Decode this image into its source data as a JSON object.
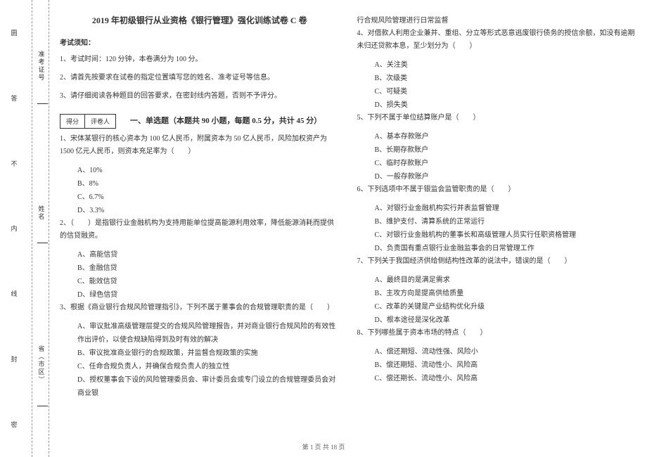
{
  "margin": {
    "binding": [
      "圆",
      "答",
      "不",
      "内",
      "线",
      "封",
      "密"
    ],
    "fields": [
      "准考证号",
      "姓名",
      "省（市区）"
    ]
  },
  "title": "2019 年初级银行从业资格《银行管理》强化训练试卷 C 卷",
  "notice": {
    "heading": "考试须知：",
    "items": [
      "1、考试时间：120 分钟，本卷满分为 100 分。",
      "2、请首先按要求在试卷的指定位置填写您的姓名、准考证号等信息。",
      "3、请仔细阅读各种题目的回答要求，在密封线内答题，否则不予评分。"
    ]
  },
  "scoreBox": {
    "col1": "得分",
    "col2": "评卷人"
  },
  "section1": {
    "title": "一、单选题（本题共 90 小题，每题 0.5 分，共计 45 分）"
  },
  "q1": {
    "text": "1、宋体某银行的核心资本为 100 亿人民币，附属资本为 50 亿人民币，风险加权资产为 1500 亿元人民币，则资本充足率为（　　）",
    "a": "A、10%",
    "b": "B、8%",
    "c": "C、6.7%",
    "d": "D、3.3%"
  },
  "q2": {
    "text": "2、（　　）是指银行业金融机构为支持用能单位提高能源利用效率，降低能源消耗而提供的信贷融资。",
    "a": "A、高能信贷",
    "b": "B、金融信贷",
    "c": "C、能效信贷",
    "d": "D、绿色信贷"
  },
  "q3": {
    "text": "3、根据《商业银行合规风险管理指引》，下列不属于董事会的合规管理职责的是（　　）",
    "a": "A、审议批准高级管理层提交的合规风险管理报告，并对商业银行合规风险的有效性作出评价，以使合规缺陷得到及时有效的解决",
    "b": "B、审议批准商业银行的合规政策，并监督合规政策的实施",
    "c": "C、任命合规负责人，并确保合规负责人的独立性",
    "d": "D、授权董事会下设的风险管理委员会、审计委员会或专门设立的合规管理委员会对商业银"
  },
  "q3_cont": "行合规风险管理进行日常监督",
  "q4": {
    "text": "4、对借款人利用企业兼并、重组、分立等形式恶意逃废银行债务的授信余额，如没有逾期未归还贷款本息，至少划分为（　　）",
    "a": "A、关注类",
    "b": "B、次级类",
    "c": "C、可疑类",
    "d": "D、损失类"
  },
  "q5": {
    "text": "5、下列不属于单位结算账户是（　　）",
    "a": "A、基本存款账户",
    "b": "B、长期存款账户",
    "c": "C、临时存款账户",
    "d": "D、一般存款账户"
  },
  "q6": {
    "text": "6、下列选项中不属于银监会监管职责的是（　　）",
    "a": "A、对银行业金融机构实行并表监督管理",
    "b": "B、维护支付、清算系统的正常运行",
    "c": "C、对银行业金融机构的董事长和高级管理人员实行任职资格管理",
    "d": "D、负责国有重点银行业金融监事会的日常管理工作"
  },
  "q7": {
    "text": "7、下列关于我国经济供给侧结构性改革的说法中，错误的是（　　）",
    "a": "A、最终目的是满足需求",
    "b": "B、主攻方向是提高供给质量",
    "c": "C、改革的关键是产业结构优化升级",
    "d": "D、根本途径是深化改革"
  },
  "q8": {
    "text": "8、下列哪些属于资本市场的特点（　　）",
    "a": "A、偿还期短、流动性强、风险小",
    "b": "B、偿还期短、流动性小、风险高",
    "c": "C、偿还期长、流动性小、风险高"
  },
  "footer": "第 1 页 共 18 页"
}
